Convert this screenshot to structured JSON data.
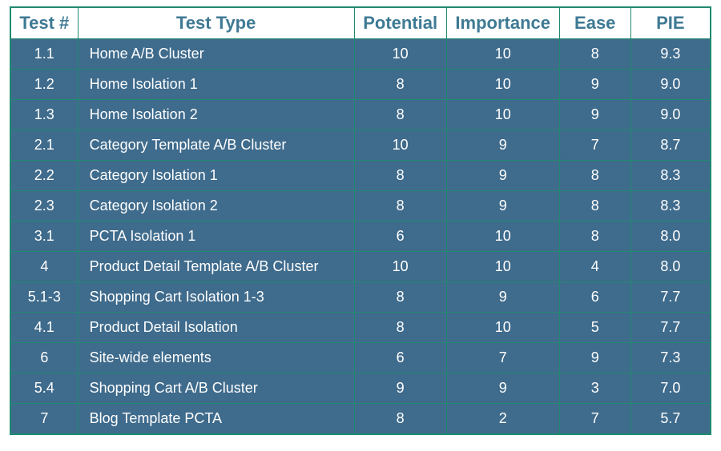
{
  "chart_data": {
    "type": "table",
    "title": "",
    "columns": [
      "Test #",
      "Test Type",
      "Potential",
      "Importance",
      "Ease",
      "PIE"
    ],
    "rows": [
      {
        "num": "1.1",
        "type": "Home A/B Cluster",
        "potential": 10,
        "importance": 10,
        "ease": 8,
        "pie": 9.3
      },
      {
        "num": "1.2",
        "type": "Home Isolation 1",
        "potential": 8,
        "importance": 10,
        "ease": 9,
        "pie": 9.0
      },
      {
        "num": "1.3",
        "type": "Home Isolation 2",
        "potential": 8,
        "importance": 10,
        "ease": 9,
        "pie": 9.0
      },
      {
        "num": "2.1",
        "type": "Category Template A/B Cluster",
        "potential": 10,
        "importance": 9,
        "ease": 7,
        "pie": 8.7
      },
      {
        "num": "2.2",
        "type": "Category Isolation 1",
        "potential": 8,
        "importance": 9,
        "ease": 8,
        "pie": 8.3
      },
      {
        "num": "2.3",
        "type": "Category Isolation 2",
        "potential": 8,
        "importance": 9,
        "ease": 8,
        "pie": 8.3
      },
      {
        "num": "3.1",
        "type": "PCTA Isolation 1",
        "potential": 6,
        "importance": 10,
        "ease": 8,
        "pie": 8.0
      },
      {
        "num": "4",
        "type": "Product Detail Template A/B Cluster",
        "potential": 10,
        "importance": 10,
        "ease": 4,
        "pie": 8.0
      },
      {
        "num": "5.1-3",
        "type": "Shopping Cart Isolation 1-3",
        "potential": 8,
        "importance": 9,
        "ease": 6,
        "pie": 7.7
      },
      {
        "num": "4.1",
        "type": "Product Detail Isolation",
        "potential": 8,
        "importance": 10,
        "ease": 5,
        "pie": 7.7
      },
      {
        "num": "6",
        "type": "Site-wide elements",
        "potential": 6,
        "importance": 7,
        "ease": 9,
        "pie": 7.3
      },
      {
        "num": "5.4",
        "type": "Shopping Cart A/B Cluster",
        "potential": 9,
        "importance": 9,
        "ease": 3,
        "pie": 7.0
      },
      {
        "num": "7",
        "type": "Blog Template PCTA",
        "potential": 8,
        "importance": 2,
        "ease": 7,
        "pie": 5.7
      }
    ]
  }
}
